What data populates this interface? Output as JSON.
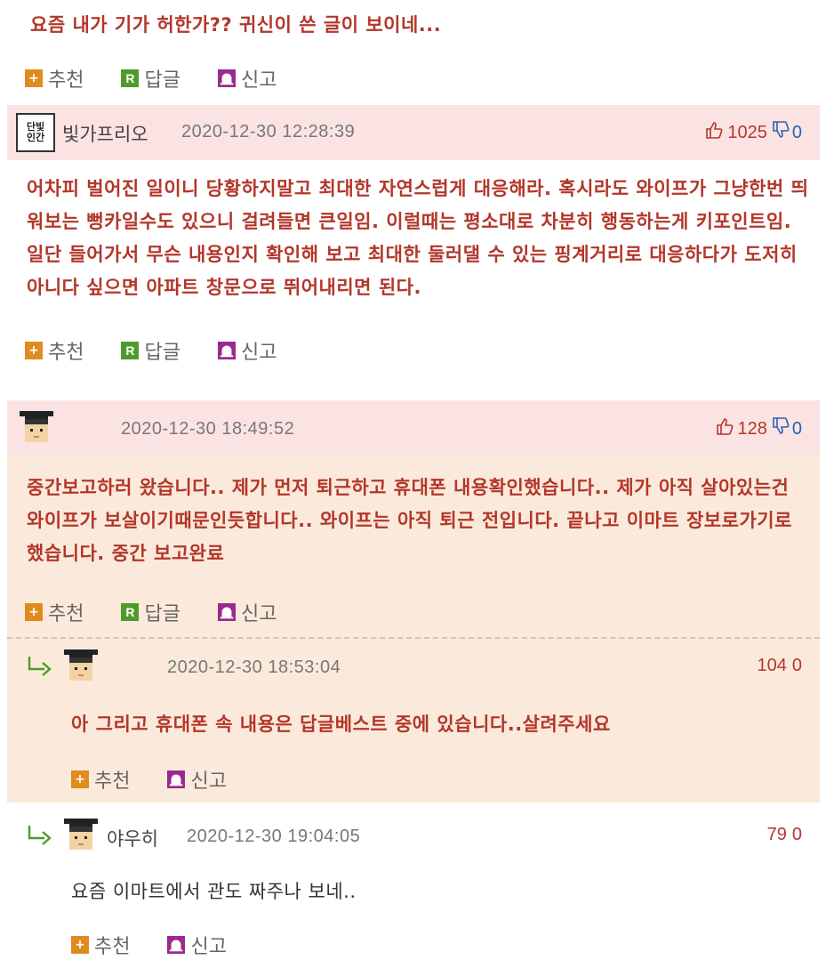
{
  "top_comment": {
    "text": "요즘 내가 기가 허한가?? 귀신이 쓴 글이 보이네..."
  },
  "actions": {
    "recommend": "추천",
    "reply": "답글",
    "report": "신고"
  },
  "comments": [
    {
      "nickname": "빛가프리오",
      "avatar_label": "단빛인간",
      "date": "2020-12-30 12:28:39",
      "up": "1025",
      "down": "0",
      "text": "어차피 벌어진 일이니 당황하지말고 최대한 자연스럽게 대응해라. 혹시라도 와이프가 그냥한번 띄워보는 뻥카일수도 있으니 걸려들면 큰일임. 이럴때는 평소대로 차분히 행동하는게 키포인트임. 일단 들어가서 무슨 내용인지 확인해 보고 최대한 둘러댈 수 있는 핑계거리로 대응하다가 도저히 아니다 싶으면 아파트 창문으로 뛰어내리면 된다."
    },
    {
      "nickname": "",
      "date": "2020-12-30 18:49:52",
      "up": "128",
      "down": "0",
      "text": "중간보고하러 왔습니다.. 제가 먼저 퇴근하고 휴대폰 내용확인했습니다.. 제가 아직 살아있는건 와이프가 보살이기때문인듯합니다.. 와이프는 아직 퇴근 전입니다. 끝나고 이마트 장보로가기로했습니다. 중간 보고완료"
    }
  ],
  "replies": [
    {
      "nickname": "",
      "date": "2020-12-30 18:53:04",
      "up": "104",
      "down": "0",
      "text": "아 그리고 휴대폰 속 내용은 답글베스트 중에 있습니다..살려주세요"
    },
    {
      "nickname": "야우히",
      "date": "2020-12-30 19:04:05",
      "up": "79",
      "down": "0",
      "text": "요즘 이마트에서 관도 짜주나 보네.."
    }
  ],
  "colors": {
    "accent_red": "#b3362a",
    "header_pink": "#fbe3e3",
    "beige": "#fbeadb",
    "reply_arrow": "#4e9a2a"
  }
}
